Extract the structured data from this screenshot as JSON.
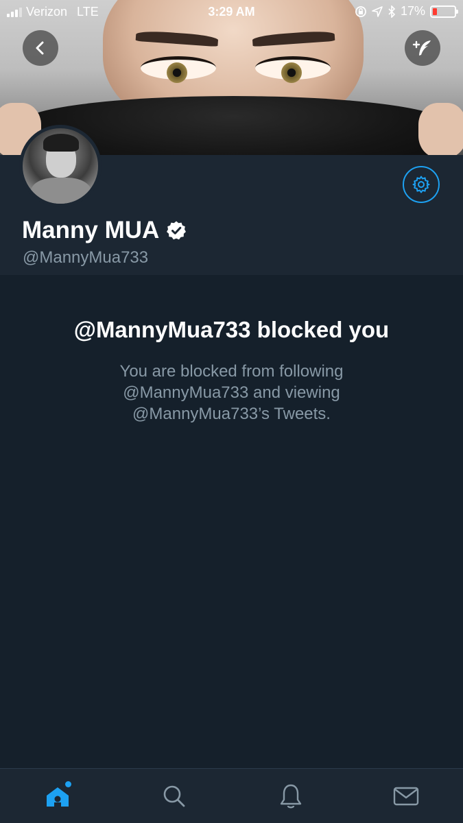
{
  "status_bar": {
    "carrier": "Verizon",
    "network": "LTE",
    "time": "3:29 AM",
    "battery": "17%"
  },
  "header": {
    "back_icon": "chevron-left-icon",
    "follow_icon": "add-tweet-feather-icon"
  },
  "profile": {
    "display_name": "Manny MUA",
    "verified": true,
    "handle": "@MannyMua733",
    "settings_icon": "gear-icon"
  },
  "blocked": {
    "title": "@MannyMua733 blocked you",
    "line1": "You are blocked from following",
    "line2": "@MannyMua733 and viewing",
    "line3": "@MannyMua733’s Tweets."
  },
  "tab_bar": {
    "items": [
      {
        "name": "home",
        "icon": "home-icon",
        "active": true
      },
      {
        "name": "search",
        "icon": "search-icon",
        "active": false
      },
      {
        "name": "notifications",
        "icon": "bell-icon",
        "active": false
      },
      {
        "name": "messages",
        "icon": "envelope-icon",
        "active": false
      }
    ]
  },
  "colors": {
    "background": "#15202b",
    "panel": "#1c2733",
    "accent": "#1da1f2",
    "secondary_text": "#8899a6"
  }
}
